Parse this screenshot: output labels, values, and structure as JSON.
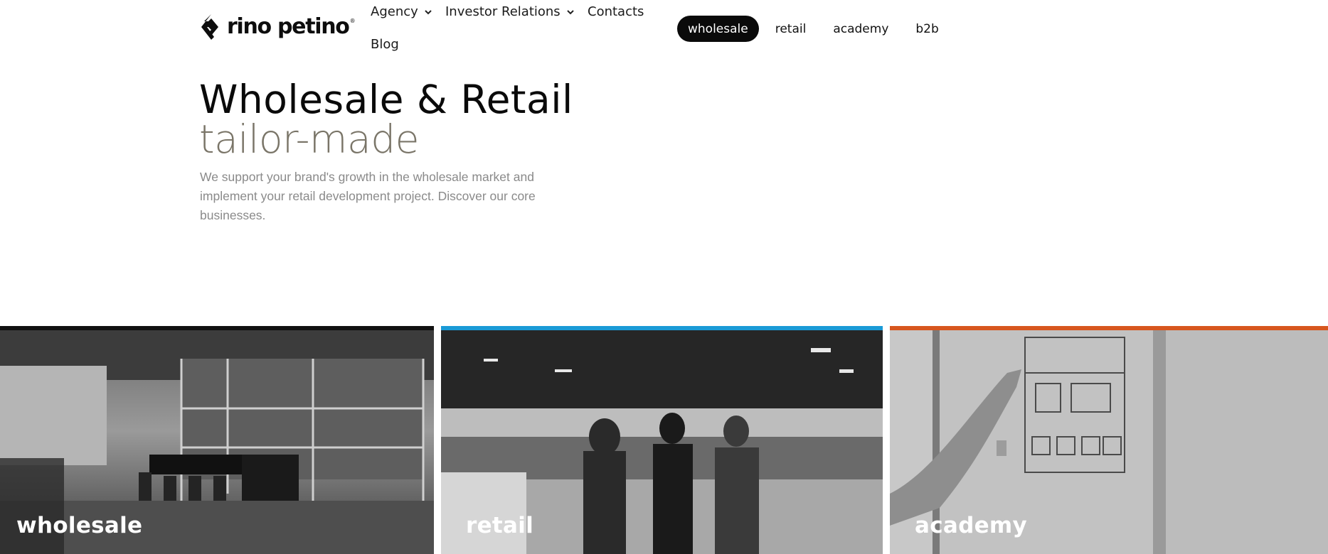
{
  "brand": {
    "name": "rino petino",
    "reg": "®"
  },
  "nav": {
    "agency": "Agency",
    "investor": "Investor Relations",
    "contacts": "Contacts",
    "blog": "Blog"
  },
  "segments": {
    "items": [
      "wholesale",
      "retail",
      "academy",
      "b2b"
    ],
    "active": "wholesale"
  },
  "hero": {
    "title": "Wholesale & Retail",
    "subtitle": "tailor-made",
    "description": "We support your brand's growth in the wholesale market and implement your retail development project. Discover our core businesses."
  },
  "cards": [
    {
      "label": "wholesale",
      "accent": "#111111"
    },
    {
      "label": "retail",
      "accent": "#1a9ad6"
    },
    {
      "label": "academy",
      "accent": "#d7561e"
    }
  ],
  "colors": {
    "text": "#111111",
    "subtitle": "#7a7568",
    "muted": "#8a8a8a"
  }
}
